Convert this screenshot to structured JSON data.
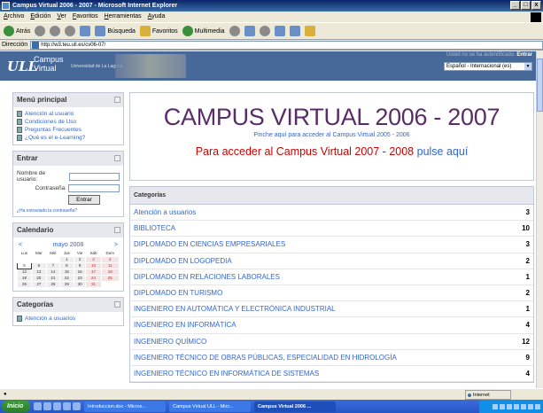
{
  "window": {
    "title": "Campus Virtual 2006 - 2007 - Microsoft Internet Explorer"
  },
  "menu": [
    "Archivo",
    "Edición",
    "Ver",
    "Favoritos",
    "Herramientas",
    "Ayuda"
  ],
  "toolbar": {
    "back": "Atrás",
    "search": "Búsqueda",
    "favorites": "Favoritos",
    "multimedia": "Multimedia"
  },
  "address": {
    "label": "Dirección",
    "url": "http://w3.teu.ull.es/cv06-07/"
  },
  "header": {
    "logo": "ULL",
    "campus_line1": "Campus",
    "campus_line2": "Virtual",
    "university": "Universidad de La Laguna",
    "login_status": "Usted no se ha autentificado.",
    "login_link": "Entrar",
    "language": "Español - Internacional (es)"
  },
  "main_menu": {
    "title": "Menú principal",
    "items": [
      "Atención al usuario",
      "Condiciones de Uso",
      "Preguntas Frecuentes",
      "¿Qué es el e-Learning?"
    ]
  },
  "login_block": {
    "title": "Entrar",
    "username_label": "Nombre de usuario:",
    "password_label": "Contraseña:",
    "submit": "Entrar",
    "forgot": "¿Ha extraviado la contraseña?"
  },
  "calendar": {
    "title": "Calendario",
    "month": "mayo 2008",
    "prev": "<",
    "next": ">",
    "days": [
      "Lun",
      "Mar",
      "Mié",
      "Jue",
      "Vie",
      "Sáb",
      "Dom"
    ],
    "weeks": [
      [
        "",
        "",
        "",
        "1",
        "2",
        "3",
        "4"
      ],
      [
        "5",
        "6",
        "7",
        "8",
        "9",
        "10",
        "11"
      ],
      [
        "12",
        "13",
        "14",
        "15",
        "16",
        "17",
        "18"
      ],
      [
        "19",
        "20",
        "21",
        "22",
        "23",
        "24",
        "25"
      ],
      [
        "26",
        "27",
        "28",
        "29",
        "30",
        "31",
        ""
      ]
    ]
  },
  "side_categories": {
    "title": "Categorías",
    "items": [
      "Atención a usuarios"
    ]
  },
  "hero": {
    "title": "CAMPUS VIRTUAL 2006 - 2007",
    "old_link": "Pinche aquí para acceder al Campus Virtual 2005 - 2006",
    "access_text": "Para acceder al Campus Virtual 2007 - 2008",
    "access_link": "pulse aquí"
  },
  "categories": {
    "title": "Categorías",
    "rows": [
      {
        "name": "Atención a usuarios",
        "count": "3"
      },
      {
        "name": "BIBLIOTECA",
        "count": "10"
      },
      {
        "name": "DIPLOMADO EN CIENCIAS EMPRESARIALES",
        "count": "3"
      },
      {
        "name": "DIPLOMADO EN LOGOPEDIA",
        "count": "2"
      },
      {
        "name": "DIPLOMADO EN RELACIONES LABORALES",
        "count": "1"
      },
      {
        "name": "DIPLOMADO EN TURISMO",
        "count": "2"
      },
      {
        "name": "INGENIERO EN AUTOMÁTICA Y ELECTRÓNICA INDUSTRIAL",
        "count": "1"
      },
      {
        "name": "INGENIERO EN INFORMÁTICA",
        "count": "4"
      },
      {
        "name": "INGENIERO QUÍMICO",
        "count": "12"
      },
      {
        "name": "INGENIERO TÉCNICO DE OBRAS PÚBLICAS, ESPECIALIDAD EN HIDROLOGÍA",
        "count": "9"
      },
      {
        "name": "INGENIERO TÉCNICO EN INFORMÁTICA DE SISTEMAS",
        "count": "4"
      }
    ]
  },
  "status": {
    "zone": "Internet"
  },
  "taskbar": {
    "start": "Inicio",
    "tasks": [
      "Introduccion.doc - Micros...",
      "Campus Virtual ULL - Micr...",
      "Campus Virtual 2006 ..."
    ]
  }
}
